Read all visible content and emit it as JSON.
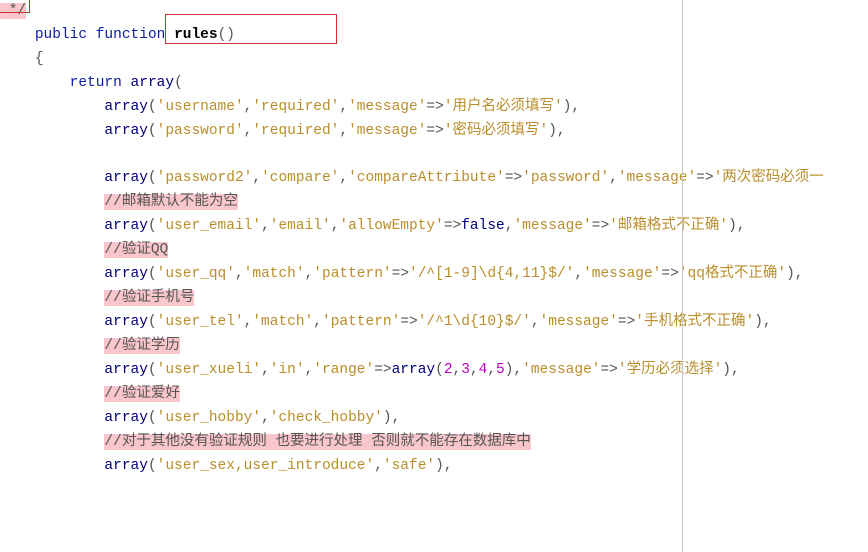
{
  "line0_cmt": " */",
  "kw_public": "public",
  "kw_function": "function",
  "fn_name": "rules",
  "fn_parens": "()",
  "brace_open": "{",
  "kw_return": "return",
  "kw_array": "array",
  "r0": {
    "f": "'username'",
    "v": "'required'",
    "mk": "'message'",
    "mv": "'用户名必须填写'"
  },
  "r1": {
    "f": "'password'",
    "v": "'required'",
    "mk": "'message'",
    "mv": "'密码必须填写'"
  },
  "r2": {
    "f": "'password2'",
    "v": "'compare'",
    "ak": "'compareAttribute'",
    "av": "'password'",
    "mk": "'message'",
    "mv": "'两次密码必须一"
  },
  "c3": "//邮箱默认不能为空",
  "r3": {
    "f": "'user_email'",
    "v": "'email'",
    "ak": "'allowEmpty'",
    "av_false": "false",
    "mk": "'message'",
    "mv": "'邮箱格式不正确'"
  },
  "c4": "//验证QQ",
  "r4": {
    "f": "'user_qq'",
    "v": "'match'",
    "pk": "'pattern'",
    "pv": "'/^[1-9]\\d{4,11}$/'",
    "mk": "'message'",
    "mv": "'qq格式不正确'"
  },
  "c5": "//验证手机号",
  "r5": {
    "f": "'user_tel'",
    "v": "'match'",
    "pk": "'pattern'",
    "pv": "'/^1\\d{10}$/'",
    "mk": "'message'",
    "mv": "'手机格式不正确'"
  },
  "c6": "//验证学历",
  "r6": {
    "f": "'user_xueli'",
    "v": "'in'",
    "rk": "'range'",
    "n1": "2",
    "n2": "3",
    "n3": "4",
    "n4": "5",
    "mk": "'message'",
    "mv": "'学历必须选择'"
  },
  "c7": "//验证爱好",
  "r7": {
    "f": "'user_hobby'",
    "v": "'check_hobby'"
  },
  "c8": "//对于其他没有验证规则 也要进行处理 否则就不能存在数据库中",
  "r8": {
    "f": "'user_sex,user_introduce'",
    "v": "'safe'"
  },
  "chart_data": {
    "type": "table",
    "note": "not a chart"
  }
}
